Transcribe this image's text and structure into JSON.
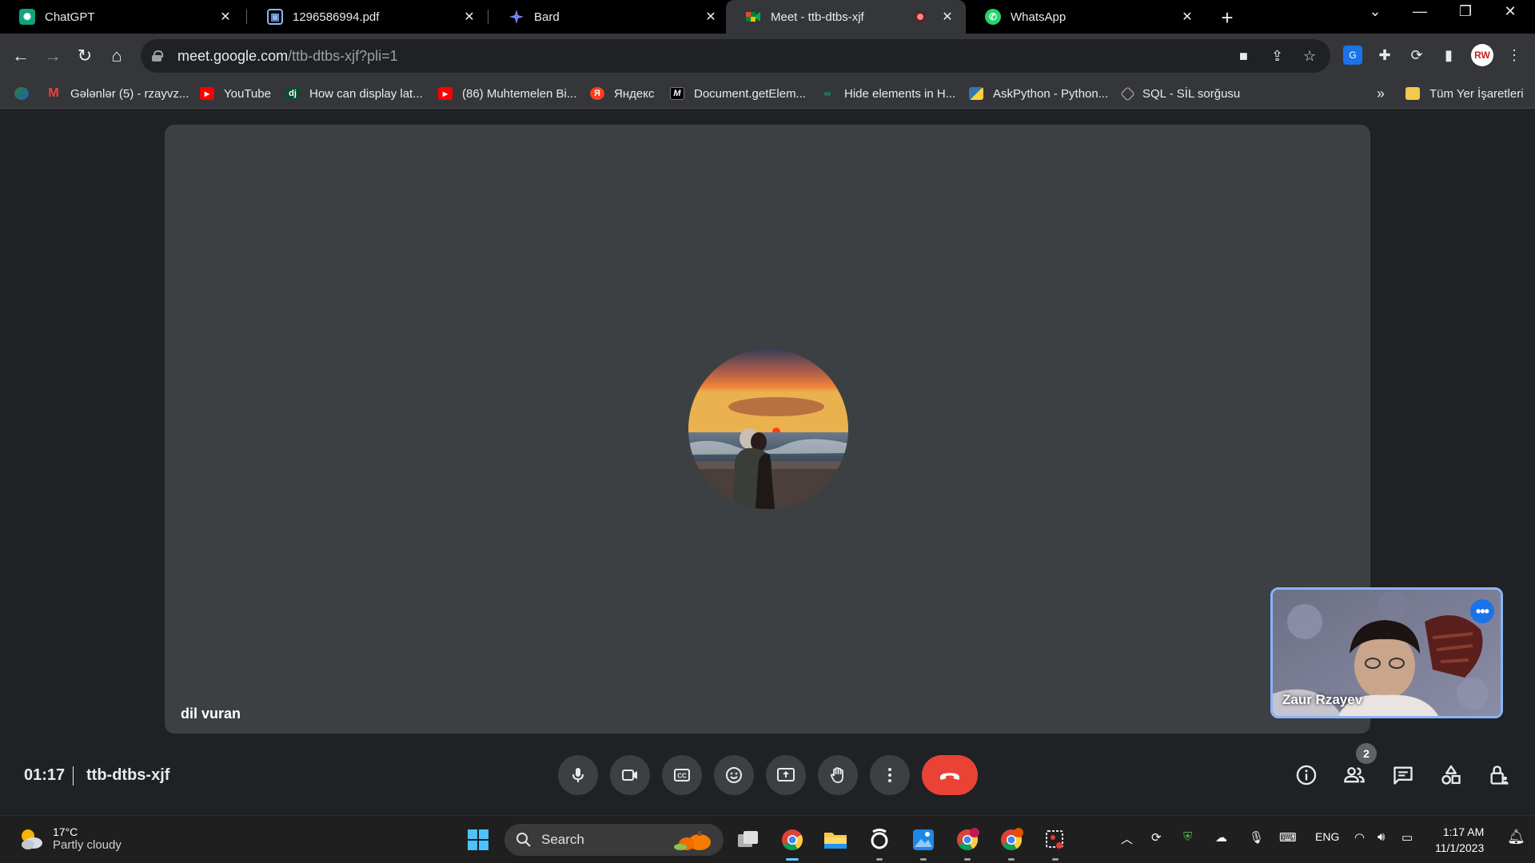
{
  "browser": {
    "tabs": [
      {
        "title": "ChatGPT",
        "icon": "chatgpt-icon",
        "close": "✕"
      },
      {
        "title": "1296586994.pdf",
        "icon": "pdf-icon",
        "close": "✕"
      },
      {
        "title": "Bard",
        "icon": "bard-icon",
        "close": "✕"
      },
      {
        "title": "Meet - ttb-dtbs-xjf",
        "icon": "meet-icon",
        "close": "✕",
        "recording": true,
        "active": true
      },
      {
        "title": "WhatsApp",
        "icon": "whatsapp-icon",
        "close": "✕"
      }
    ],
    "url_host": "meet.google.com",
    "url_path": "/ttb-dtbs-xjf?pli=1",
    "profile_initials": "RW",
    "bookmarks": [
      {
        "label": "",
        "icon": "bookmark-app-icon"
      },
      {
        "label": "Gələnlər (5) - rzayvz...",
        "icon": "gmail-icon"
      },
      {
        "label": "YouTube",
        "icon": "youtube-icon"
      },
      {
        "label": "How can display lat...",
        "icon": "django-icon"
      },
      {
        "label": "(86) Muhtemelen Bi...",
        "icon": "youtube-icon"
      },
      {
        "label": "Яндекс",
        "icon": "yandex-icon"
      },
      {
        "label": "Document.getElem...",
        "icon": "mdn-icon"
      },
      {
        "label": "Hide elements in H...",
        "icon": "w3-icon"
      },
      {
        "label": "AskPython - Python...",
        "icon": "python-icon"
      },
      {
        "label": "SQL - SİL sorğusu",
        "icon": "sql-icon"
      }
    ],
    "bookmarks_overflow": "»",
    "all_bookmarks": "Tüm Yer İşaretleri"
  },
  "meet": {
    "main_participant": "dil vuran",
    "self_participant": "Zaur Rzayev",
    "self_more": "•••",
    "elapsed": "01:17",
    "meeting_code": "ttb-dtbs-xjf",
    "people_count": "2",
    "controls": [
      "microphone",
      "camera",
      "captions",
      "reactions",
      "present",
      "raise-hand",
      "more-options",
      "leave-call"
    ],
    "side_controls": [
      "meeting-details",
      "people",
      "chat",
      "activities",
      "host-controls"
    ]
  },
  "taskbar": {
    "weather_temp": "17°C",
    "weather_condition": "Partly cloudy",
    "search_placeholder": "Search",
    "language": "ENG",
    "time": "1:17 AM",
    "date": "11/1/2023"
  },
  "colors": {
    "accent_blue": "#8ab4f8",
    "end_call_red": "#ea4335",
    "tile_gray": "#3c4043",
    "background": "#202124"
  }
}
